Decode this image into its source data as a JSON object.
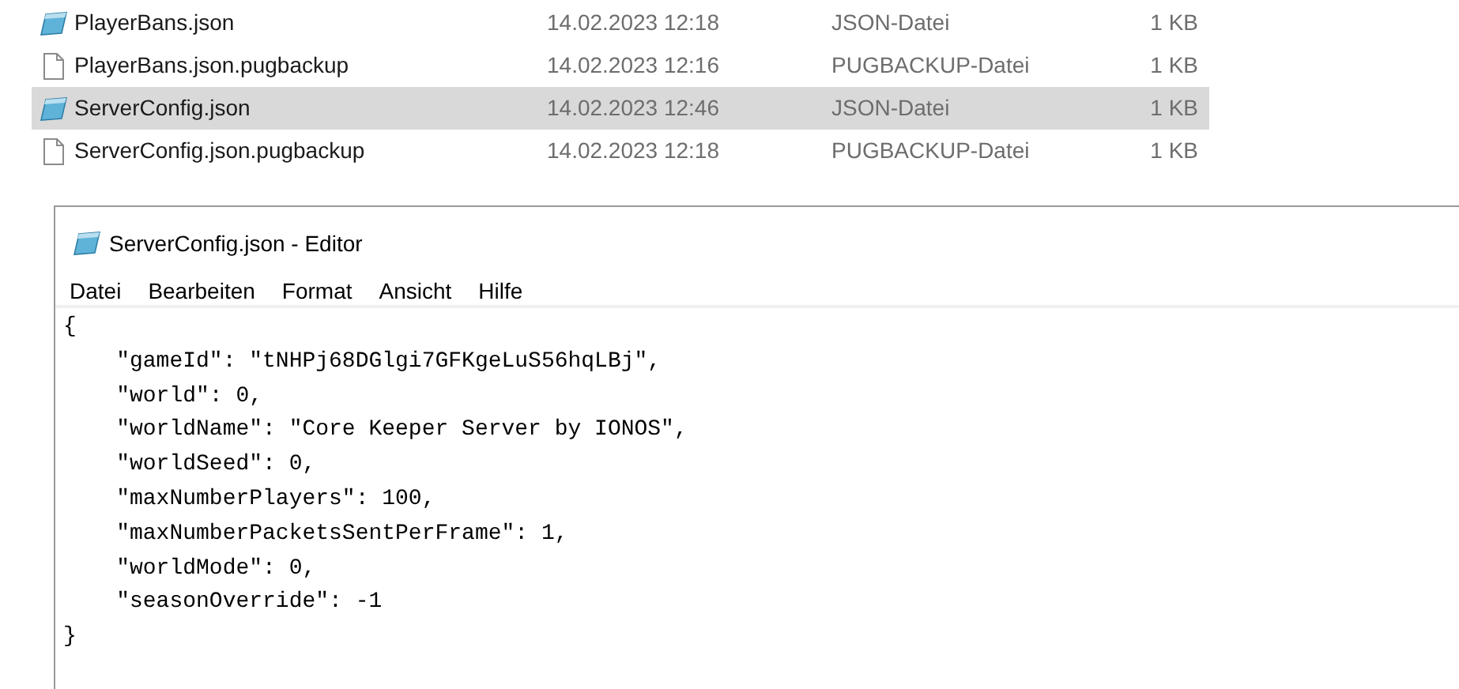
{
  "files": [
    {
      "name": "PlayerBans.json",
      "date": "14.02.2023 12:18",
      "type": "JSON-Datei",
      "size": "1 KB",
      "kind": "json",
      "selected": false
    },
    {
      "name": "PlayerBans.json.pugbackup",
      "date": "14.02.2023 12:16",
      "type": "PUGBACKUP-Datei",
      "size": "1 KB",
      "kind": "backup",
      "selected": false
    },
    {
      "name": "ServerConfig.json",
      "date": "14.02.2023 12:46",
      "type": "JSON-Datei",
      "size": "1 KB",
      "kind": "json",
      "selected": true
    },
    {
      "name": "ServerConfig.json.pugbackup",
      "date": "14.02.2023 12:18",
      "type": "PUGBACKUP-Datei",
      "size": "1 KB",
      "kind": "backup",
      "selected": false
    }
  ],
  "editor": {
    "title": "ServerConfig.json - Editor",
    "menu": [
      "Datei",
      "Bearbeiten",
      "Format",
      "Ansicht",
      "Hilfe"
    ],
    "lines": [
      "{",
      "    \"gameId\": \"tNHPj68DGlgi7GFKgeLuS56hqLBj\",",
      "    \"world\": 0,",
      "    \"worldName\": \"Core Keeper Server by IONOS\",",
      "    \"worldSeed\": 0,",
      "    \"maxNumberPlayers\": 100,",
      "    \"maxNumberPacketsSentPerFrame\": 1,",
      "    \"worldMode\": 0,",
      "    \"seasonOverride\": -1",
      "}"
    ]
  }
}
